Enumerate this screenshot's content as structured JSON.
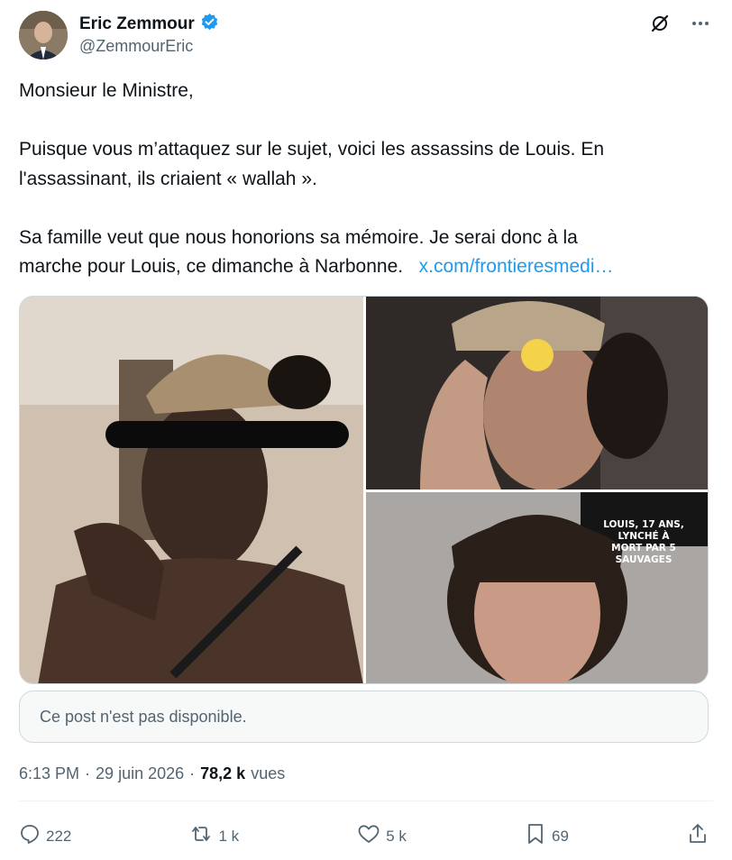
{
  "author": {
    "name": "Eric Zemmour",
    "handle": "@ZemmourEric",
    "verified_color": "#1d9bf0"
  },
  "tweet": {
    "line1": "Monsieur le Ministre,",
    "line2": "Puisque vous m’attaquez sur le sujet, voici les assassins de Louis. En",
    "line3": "l'assassinant, ils criaient « wallah ».",
    "line4": "Sa famille veut que nous honorions sa mémoire. Je serai donc à la",
    "line5": "marche pour Louis, ce dimanche à Narbonne.",
    "link": "x.com/frontieresmedi…"
  },
  "media": {
    "caption_line1": "LOUIS, 17 ANS, LYNCHÉ À",
    "caption_line2": "MORT PAR 5 SAUVAGES"
  },
  "quote": {
    "unavailable_text": "Ce post n'est pas disponible."
  },
  "meta": {
    "time": "6:13 PM",
    "sep1": "·",
    "date": "29 juin 2026",
    "sep2": "·",
    "views_count": "78,2 k",
    "views_label": "vues"
  },
  "actions": {
    "replies": "222",
    "reposts": "1 k",
    "likes": "5 k",
    "bookmarks": "69"
  },
  "icons": {
    "grok": "grok-icon",
    "more": "more-icon",
    "reply": "reply-icon",
    "repost": "repost-icon",
    "like": "heart-icon",
    "bookmark": "bookmark-icon",
    "share": "share-icon"
  }
}
